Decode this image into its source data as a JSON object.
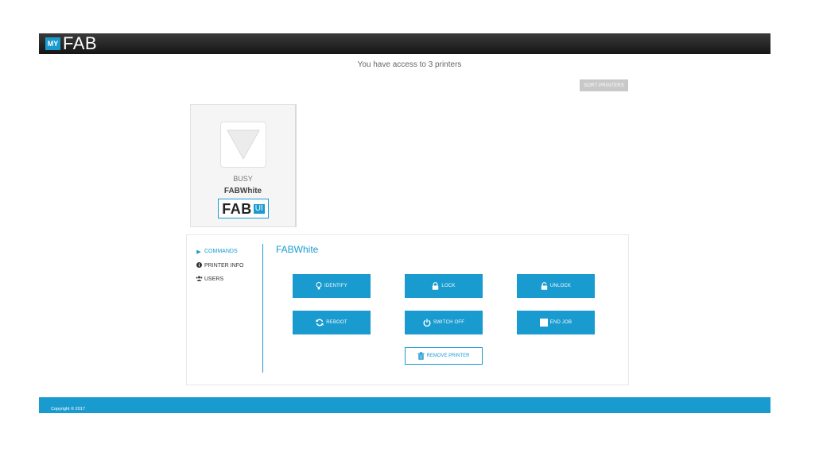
{
  "header": {
    "logo_my": "MY",
    "logo_fab": "FAB"
  },
  "main": {
    "access_text": "You have access to 3 printers",
    "sort_button": "SORT PRINTERS"
  },
  "printer_card": {
    "status": "BUSY",
    "name": "FABWhite",
    "badge_main": "FAB",
    "badge_ui": "UI"
  },
  "panel": {
    "title": "FABWhite",
    "nav": [
      {
        "label": "COMMANDS",
        "icon": "caret-right-icon",
        "active": true
      },
      {
        "label": "PRINTER INFO",
        "icon": "info-circle-icon",
        "active": false
      },
      {
        "label": "USERS",
        "icon": "users-icon",
        "active": false
      }
    ],
    "commands": {
      "identify": "IDENTIFY",
      "lock": "LOCK",
      "unlock": "UNLOCK",
      "reboot": "REBOOT",
      "switch_off": "SWITCH OFF",
      "end_job": "END JOB"
    },
    "remove": "REMOVE PRINTER"
  },
  "footer": {
    "copyright": "Copyright © 2017"
  },
  "colors": {
    "accent": "#1a9bd0",
    "topbar": "#1e1e1e"
  }
}
